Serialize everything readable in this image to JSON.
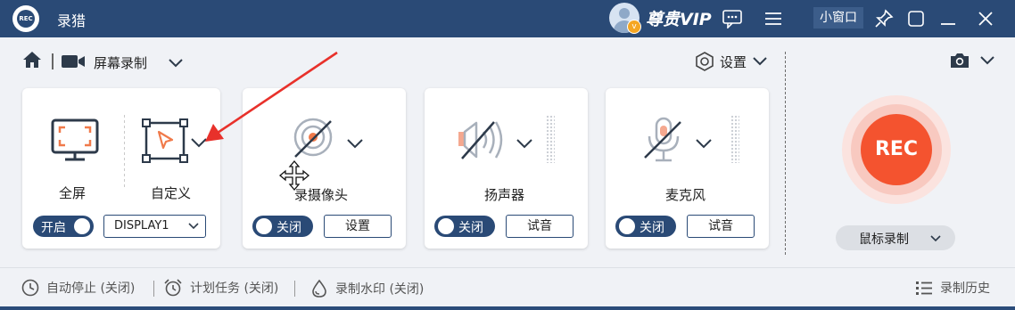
{
  "app": {
    "logo_text": "REC",
    "title": "录猎"
  },
  "titlebar": {
    "vip_label": "尊贵VIP",
    "mini_window_label": "小窗口",
    "icons": [
      "chat-icon",
      "menu-icon",
      "pin-icon",
      "minimize-icon",
      "close-icon"
    ]
  },
  "nav": {
    "mode_label": "屏幕录制",
    "settings_label": "设置"
  },
  "screen_card": {
    "fullscreen_label": "全屏",
    "custom_label": "自定义",
    "toggle_label": "开启",
    "toggle_on": true,
    "display_value": "DISPLAY1"
  },
  "webcam_card": {
    "label": "录摄像头",
    "toggle_label": "关闭",
    "button_label": "设置"
  },
  "speaker_card": {
    "label": "扬声器",
    "toggle_label": "关闭",
    "button_label": "试音"
  },
  "mic_card": {
    "label": "麦克风",
    "toggle_label": "关闭",
    "button_label": "试音"
  },
  "rec": {
    "button_label": "REC",
    "mode_label": "鼠标录制"
  },
  "footer": {
    "auto_stop": "自动停止 (关闭)",
    "schedule": "计划任务 (关闭)",
    "watermark": "录制水印 (关闭)",
    "history": "录制历史"
  },
  "colors": {
    "titlebar": "#2a4a76",
    "rec": "#f4532f",
    "annotation_arrow": "#e8312b",
    "accent_orange": "#f07a4a"
  }
}
